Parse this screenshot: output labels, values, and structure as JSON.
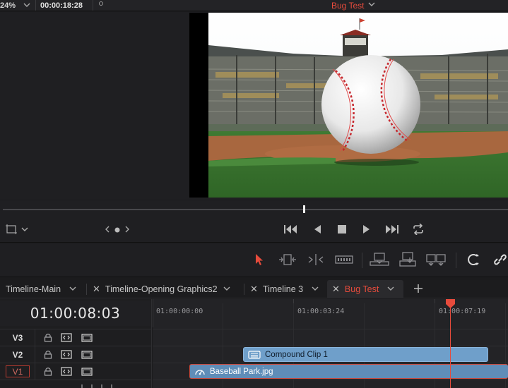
{
  "viewer_header": {
    "zoom": "24%",
    "timecode": "00:00:18:28",
    "timeline_name": "Bug Test"
  },
  "tabs": [
    {
      "label": "Timeline-Main",
      "closable": false,
      "active": false
    },
    {
      "label": "Timeline-Opening Graphics2",
      "closable": true,
      "active": false
    },
    {
      "label": "Timeline 3",
      "closable": true,
      "active": false
    },
    {
      "label": "Bug Test",
      "closable": true,
      "active": true
    }
  ],
  "timeline": {
    "timecode": "01:00:08:03",
    "ruler_labels": [
      "01:00:00:00",
      "01:00:03:24",
      "01:00:07:19"
    ],
    "tracks": [
      {
        "name": "V3"
      },
      {
        "name": "V2"
      },
      {
        "name": "V1"
      }
    ],
    "clips": {
      "compound": "Compound Clip 1",
      "baseball": "Baseball Park.jpg"
    }
  },
  "colors": {
    "accent_red": "#e64b3c",
    "clip_blue": "#6f9fca",
    "background": "#1b1b1d"
  },
  "icons": {
    "transport": [
      "first-frame-icon",
      "reverse-play-icon",
      "stop-icon",
      "play-icon",
      "last-frame-icon",
      "loop-icon"
    ],
    "edit_tools": [
      "selection-arrow-icon",
      "trim-edit-icon",
      "dynamic-trim-icon",
      "blade-edit-icon",
      "insert-clip-icon",
      "overwrite-clip-icon",
      "replace-clip-icon",
      "snapping-icon",
      "linked-selection-icon"
    ],
    "track_controls": [
      "lock-icon",
      "auto-select-icon",
      "disable-track-icon"
    ]
  }
}
